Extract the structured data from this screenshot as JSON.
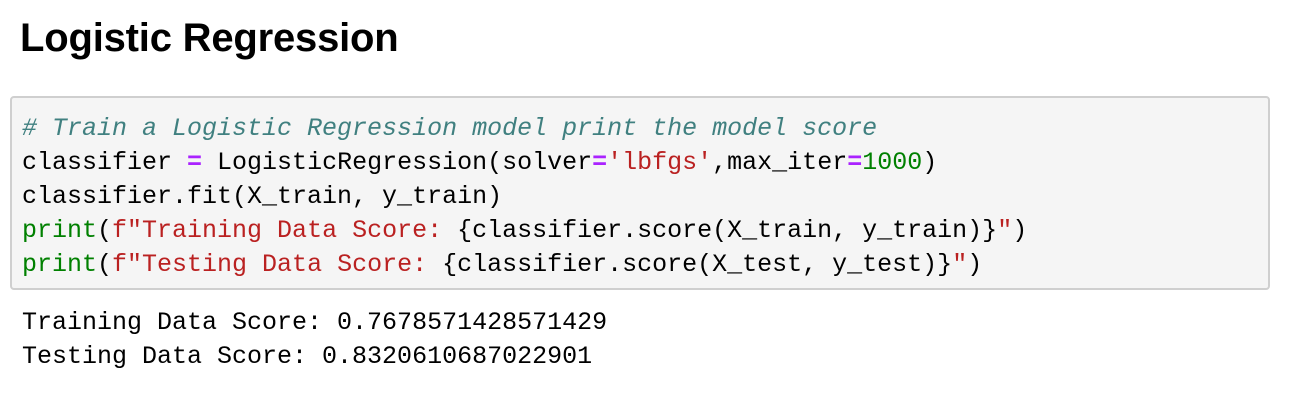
{
  "heading": "Logistic Regression",
  "code_cell": {
    "lines": [
      {
        "comment": "# Train a Logistic Regression model print the model score"
      },
      {
        "t1": "classifier ",
        "op1": "=",
        "t2": " LogisticRegression(solver",
        "op2": "=",
        "str1": "'lbfgs'",
        "t3": ",max_iter",
        "op3": "=",
        "num1": "1000",
        "t4": ")"
      },
      {
        "t1": "classifier.fit(X_train, y_train)"
      },
      {
        "builtin": "print",
        "t1": "(",
        "str1": "f\"Training Data Score: ",
        "t2": "{classifier.score(X_train, y_train)}",
        "str2": "\"",
        "t3": ")"
      },
      {
        "builtin": "print",
        "t1": "(",
        "str1": "f\"Testing Data Score: ",
        "t2": "{classifier.score(X_test, y_test)}",
        "str2": "\"",
        "t3": ")"
      }
    ]
  },
  "output": {
    "lines": [
      "Training Data Score: 0.7678571428571429",
      "Testing Data Score: 0.8320610687022901"
    ]
  },
  "syntax_colors": {
    "comment": "#408080",
    "operator": "#aa22ff",
    "string": "#ba2121",
    "number": "#008000",
    "builtin": "#008000",
    "cell_background": "#f5f5f5",
    "cell_border": "#cfcfcf"
  }
}
